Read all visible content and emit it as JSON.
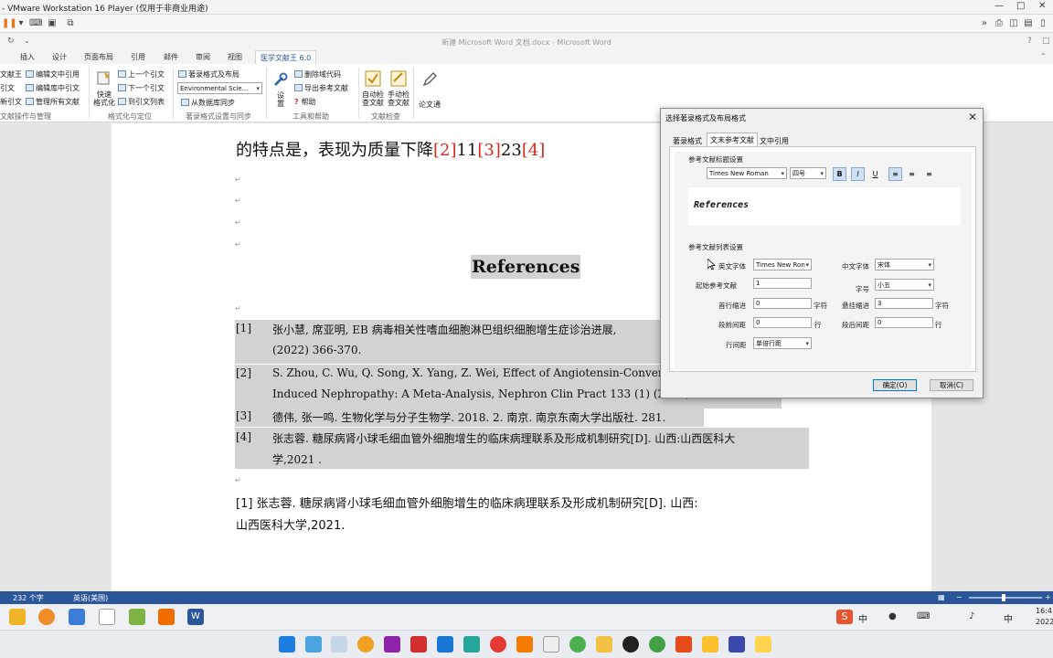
{
  "vmware": {
    "title": "- VMware Workstation 16 Player (仅用于非商业用途)"
  },
  "word": {
    "doc_title": "新建 Microsoft Word 文档.docx - Microsoft Word",
    "tabs": [
      "插入",
      "设计",
      "页面布局",
      "引用",
      "邮件",
      "审阅",
      "视图",
      "医学文献王 6.0"
    ],
    "ribbon": {
      "g1_items": [
        "文献王",
        "引文",
        "新引文"
      ],
      "g1b_items": [
        "编辑文中引用",
        "编辑库中引文",
        "管理所有文献"
      ],
      "g1_label": "文献操作与管理",
      "quick_format_label": "快速\n格式化",
      "nav_items": [
        "上一个引文",
        "下一个引文",
        "到引文列表"
      ],
      "g2_label": "格式化与定位",
      "style_items": [
        "著录格式及布局",
        "从数据库同步"
      ],
      "style_select": "Environmental Scie...",
      "g3_label": "著录格式设置与同步",
      "settings_label": "设\n置",
      "tools_items": [
        "删除域代码",
        "导出参考文献",
        "帮助"
      ],
      "g4_label": "工具和帮助",
      "auto_check_label": "自动检\n查文献",
      "manual_check_label": "手动检\n查文献",
      "g5_label": "文献检查",
      "essay_label": "论文通"
    },
    "document": {
      "line1_text": "的特点是，表现为质量下降",
      "line1_cite1": "[2]",
      "line1_mid1": "11",
      "line1_cite2": "[3]",
      "line1_mid2": "23",
      "line1_cite3": "[4]",
      "references_heading": "References",
      "refs": [
        {
          "num": "[1]",
          "line1": "张小慧, 席亚明, EB 病毒相关性嗜血细胞淋巴组织细胞增生症诊治进展,",
          "line2": "(2022) 366-370."
        },
        {
          "num": "[2]",
          "line1": "S. Zhou, C. Wu, Q. Song, X. Yang, Z. Wei, Effect of Angiotensin-Converting E",
          "line2": "Induced Nephropathy: A Meta-Analysis, Nephron Clin Pract 133 (1) (2016) 1"
        },
        {
          "num": "[3]",
          "line1": "德伟, 张一鸣. 生物化学与分子生物学. 2018. 2.  南京.  南京东南大学出版社. 281."
        },
        {
          "num": "[4]",
          "line1": "张志蓉. 糖尿病肾小球毛细血管外细胞增生的临床病理联系及形成机制研究[D].  山西:山西医科大",
          "line2": "学,2021 ."
        }
      ],
      "footnote_line1": "[1]  张志蓉. 糖尿病肾小球毛细血管外细胞增生的临床病理联系及形成机制研究[D].  山西:",
      "footnote_line2": "山西医科大学,2021."
    },
    "status": {
      "word_count": "232 个字",
      "language": "英语(美国)"
    }
  },
  "dialog": {
    "title": "选择著录格式及布局格式",
    "tabs": [
      "著录格式",
      "文末参考文献",
      "文中引用"
    ],
    "active_tab": 1,
    "heading_section_label": "参考文献标题设置",
    "heading_font": "Times New Roman",
    "heading_size": "四号",
    "format_buttons": [
      "B",
      "I",
      "U"
    ],
    "preview_text": "References",
    "list_section_label": "参考文献列表设置",
    "en_font_label": "英文字体",
    "en_font_value": "Times New Ron",
    "cn_font_label": "中文字体",
    "cn_font_value": "宋体",
    "start_num_label": "起始参考文献",
    "start_num_value": "1",
    "size_label": "字号",
    "size_value": "小五",
    "first_indent_label": "首行缩进",
    "first_indent_value": "0",
    "first_indent_unit": "字符",
    "hanging_indent_label": "悬挂缩进",
    "hanging_indent_value": "3",
    "hanging_indent_unit": "字符",
    "space_before_label": "段前间距",
    "space_before_value": "0",
    "space_before_unit": "行",
    "space_after_label": "段后间距",
    "space_after_value": "0",
    "space_after_unit": "行",
    "line_spacing_label": "行间距",
    "line_spacing_value": "单倍行距",
    "ok_label": "确定(O)",
    "cancel_label": "取消(C)"
  },
  "tray": {
    "ime": "中",
    "time": "16:4",
    "date": "2022"
  }
}
